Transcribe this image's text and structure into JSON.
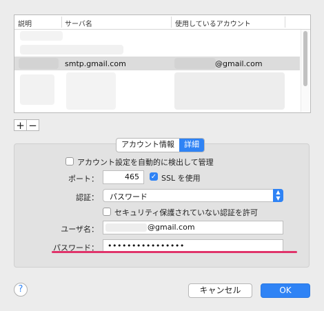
{
  "table": {
    "columns": [
      "説明",
      "サーバ名",
      "使用しているアカウント"
    ],
    "selected_row": {
      "server": "smtp.gmail.com",
      "account": "@gmail.com"
    }
  },
  "add_label": "+",
  "remove_label": "−",
  "tabs": [
    "アカウント情報",
    "詳細"
  ],
  "details": {
    "auto_detect_label": "アカウント設定を自動的に検出して管理",
    "auto_detect_checked": false,
    "port_label": "ポート：",
    "port_value": "465",
    "ssl_label": "SSL を使用",
    "ssl_checked": true,
    "auth_label": "認証：",
    "auth_value": "パスワード",
    "insecure_label": "セキュリティ保護されていない認証を許可",
    "insecure_checked": false,
    "username_label": "ユーザ名：",
    "username_value": "@gmail.com",
    "password_label": "パスワード：",
    "password_value": "••••••••••••••••"
  },
  "help_label": "?",
  "cancel_label": "キャンセル",
  "ok_label": "OK",
  "colors": {
    "accent": "#2f83f5",
    "highlight_line": "#e0336a"
  }
}
